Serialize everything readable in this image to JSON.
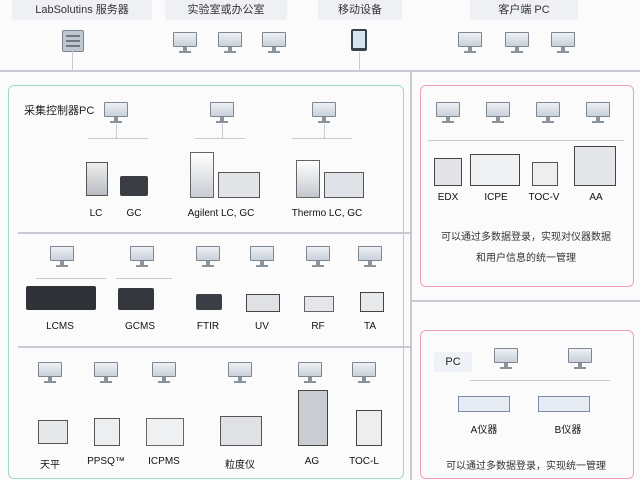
{
  "tabs": {
    "server": "LabSolutins 服务器",
    "lab_office": "实验室或办公室",
    "mobile": "移动设备",
    "client_pc": "客户端 PC"
  },
  "panel_teal": {
    "title": "采集控制器PC",
    "row1": [
      "LC",
      "GC",
      "Agilent LC, GC",
      "Thermo LC, GC"
    ],
    "row2": [
      "LCMS",
      "GCMS",
      "FTIR",
      "UV",
      "RF",
      "TA"
    ],
    "row3": [
      "天平",
      "PPSQ™",
      "ICPMS",
      "粒度仪",
      "AG",
      "TOC-L"
    ]
  },
  "panel_pink_top": {
    "labels": [
      "EDX",
      "ICPE",
      "TOC-V",
      "AA"
    ],
    "note_line1": "可以通过多数据登录，实现对仪器数据",
    "note_line2": "和用户信息的统一管理"
  },
  "panel_pink_bottom": {
    "title": "PC",
    "labels": [
      "A仪器",
      "B仪器"
    ],
    "note": "可以通过多数据登录，实现统一管理"
  },
  "colors": {
    "teal_border": "#9fd6cf",
    "pink_border": "#ef9fb7",
    "network_line": "#c5cad2"
  },
  "icons": [
    "server-icon",
    "monitor-icon",
    "tablet-icon",
    "instrument-icon"
  ]
}
